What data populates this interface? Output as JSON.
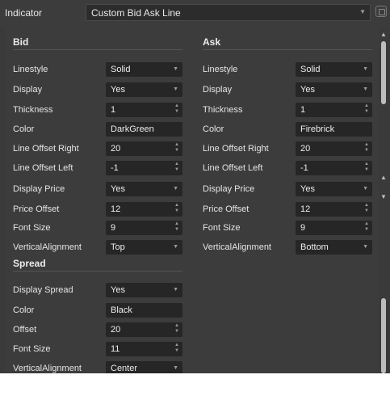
{
  "indicator": {
    "label": "Indicator",
    "value": "Custom Bid Ask Line"
  },
  "bid": {
    "title": "Bid",
    "rows": [
      {
        "label": "Linestyle",
        "value": "Solid",
        "kind": "dropdown"
      },
      {
        "label": "Display",
        "value": "Yes",
        "kind": "dropdown"
      },
      {
        "label": "Thickness",
        "value": "1",
        "kind": "spinner"
      },
      {
        "label": "Color",
        "value": "DarkGreen",
        "kind": "text"
      },
      {
        "label": "Line Offset Right",
        "value": "20",
        "kind": "spinner"
      },
      {
        "label": "Line Offset Left",
        "value": "-1",
        "kind": "spinner"
      },
      {
        "label": "Display Price",
        "value": "Yes",
        "kind": "dropdown"
      },
      {
        "label": "Price Offset",
        "value": "12",
        "kind": "spinner"
      },
      {
        "label": "Font Size",
        "value": "9",
        "kind": "spinner"
      },
      {
        "label": "VerticalAlignment",
        "value": "Top",
        "kind": "dropdown"
      }
    ]
  },
  "ask": {
    "title": "Ask",
    "rows": [
      {
        "label": "Linestyle",
        "value": "Solid",
        "kind": "dropdown"
      },
      {
        "label": "Display",
        "value": "Yes",
        "kind": "dropdown"
      },
      {
        "label": "Thickness",
        "value": "1",
        "kind": "spinner"
      },
      {
        "label": "Color",
        "value": "Firebrick",
        "kind": "text"
      },
      {
        "label": "Line Offset Right",
        "value": "20",
        "kind": "spinner"
      },
      {
        "label": "Line Offset Left",
        "value": "-1",
        "kind": "spinner"
      },
      {
        "label": "Display Price",
        "value": "Yes",
        "kind": "dropdown"
      },
      {
        "label": "Price Offset",
        "value": "12",
        "kind": "spinner"
      },
      {
        "label": "Font Size",
        "value": "9",
        "kind": "spinner"
      },
      {
        "label": "VerticalAlignment",
        "value": "Bottom",
        "kind": "dropdown"
      }
    ]
  },
  "spread": {
    "title": "Spread",
    "rows": [
      {
        "label": "Display Spread",
        "value": "Yes",
        "kind": "dropdown"
      },
      {
        "label": "Color",
        "value": "Black",
        "kind": "text"
      },
      {
        "label": "Offset",
        "value": "20",
        "kind": "spinner"
      },
      {
        "label": "Font Size",
        "value": "11",
        "kind": "spinner"
      },
      {
        "label": "VerticalAlignment",
        "value": "Center",
        "kind": "dropdown"
      }
    ]
  },
  "icons": {
    "dropdown": "chevron-down-icon",
    "spinner": "spinner-arrows-icon",
    "window": "window-icon"
  }
}
